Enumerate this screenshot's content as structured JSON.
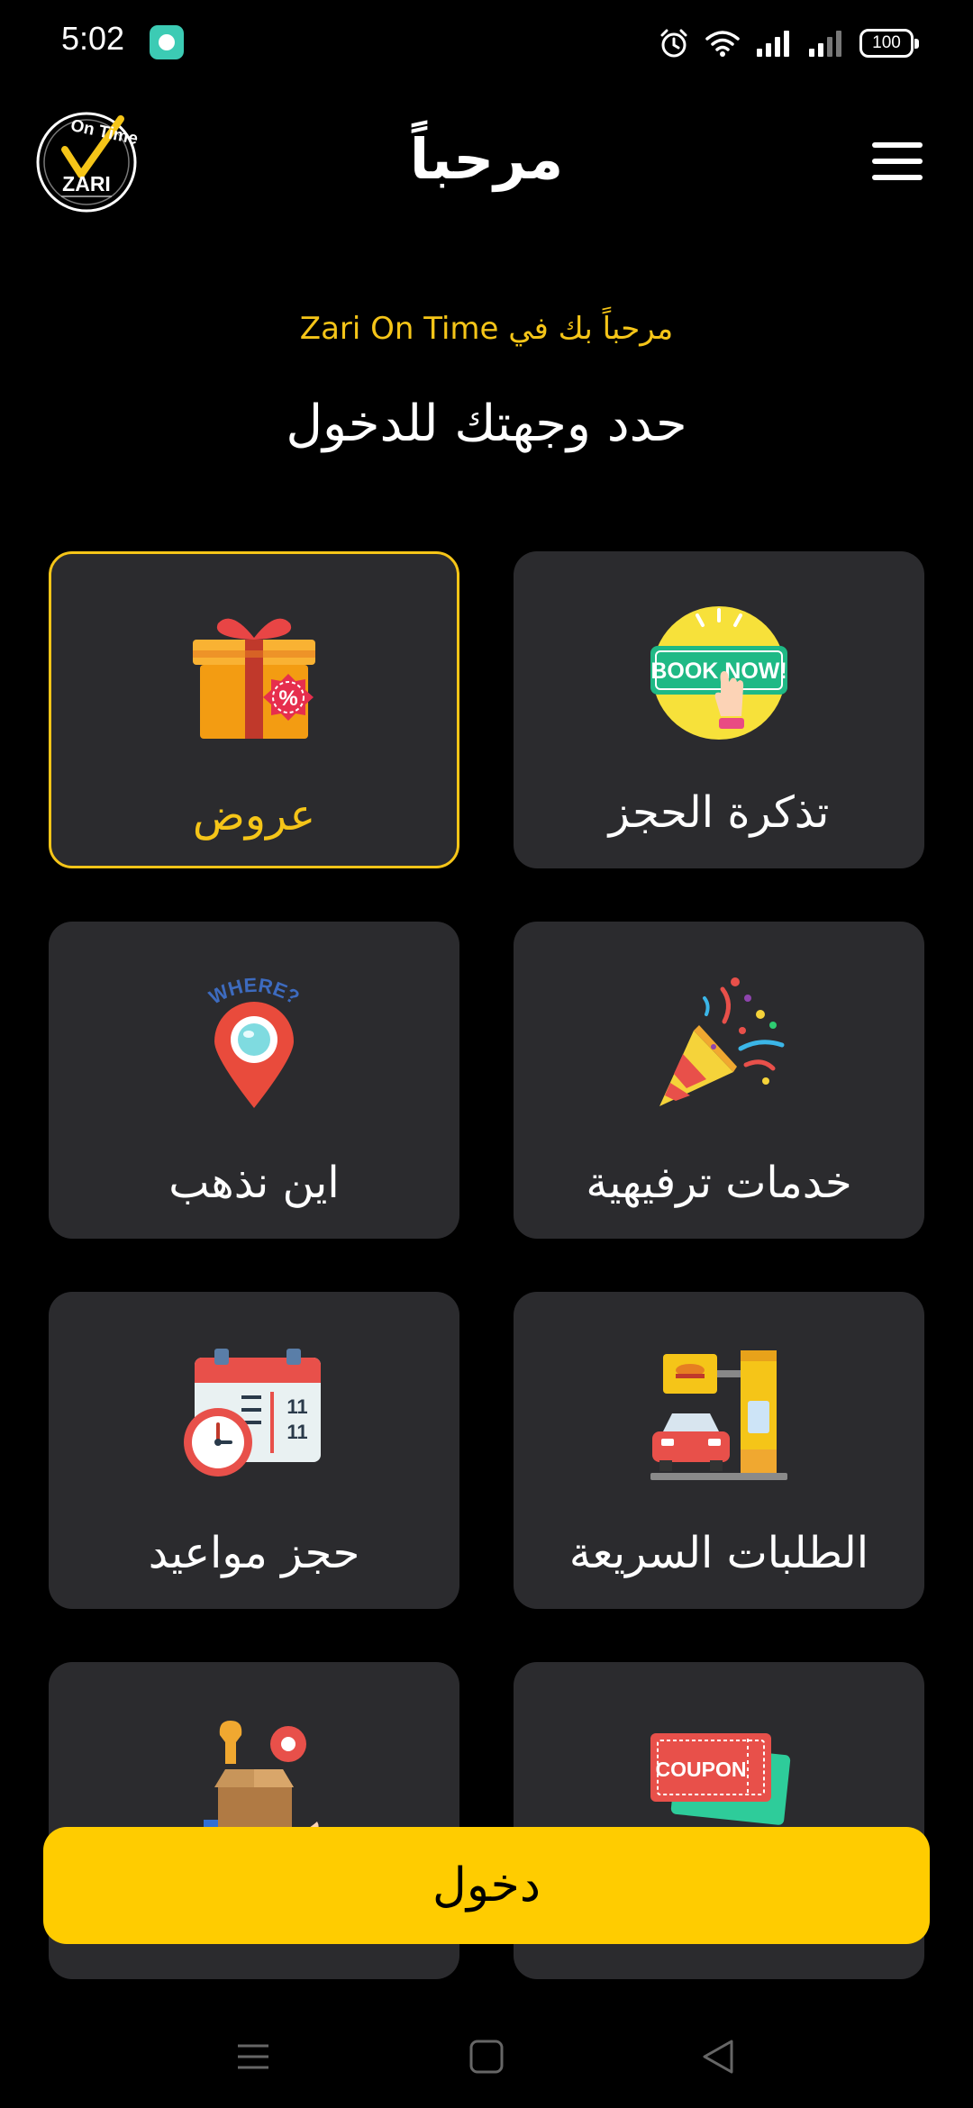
{
  "status": {
    "time": "5:02",
    "battery": "100"
  },
  "header": {
    "title": "مرحباً",
    "logo_text_top": "On Time",
    "logo_text_main": "ZARI"
  },
  "welcome": {
    "line": "مرحباً بك في Zari On Time",
    "destination": "حدد وجهتك للدخول"
  },
  "cards": [
    {
      "label": "تذكرة الحجز",
      "icon": "book-now-icon",
      "badge_text": "BOOK NOW!"
    },
    {
      "label": "عروض",
      "icon": "gift-discount-icon",
      "selected": true
    },
    {
      "label": "خدمات ترفيهية",
      "icon": "party-popper-icon"
    },
    {
      "label": "اين نذهب",
      "icon": "where-location-pin-icon",
      "badge_text": "WHERE?"
    },
    {
      "label": "الطلبات السريعة",
      "icon": "drive-thru-icon"
    },
    {
      "label": "حجز مواعيد",
      "icon": "calendar-clock-icon",
      "day_number": "11"
    },
    {
      "label": "",
      "icon": "coupon-icon",
      "badge_text": "COUPON"
    },
    {
      "label": "",
      "icon": "service-box-icon"
    }
  ],
  "login": {
    "label": "دخول"
  },
  "colors": {
    "accent": "#ffcc00",
    "card": "#2b2b2e",
    "background": "#000000",
    "highlight_text": "#f5c518"
  }
}
